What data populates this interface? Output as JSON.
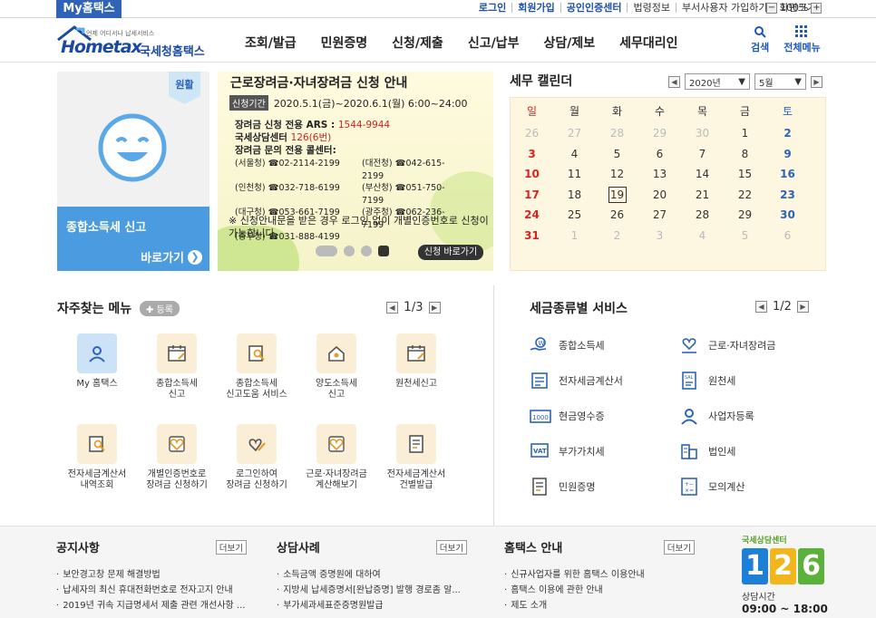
{
  "topbar": {
    "brand": "My홈택스",
    "links": [
      "로그인",
      "회원가입",
      "공인인증센터",
      "법령정보",
      "부서사용자 가입하기",
      "화면크기"
    ],
    "zoom_level": "100%"
  },
  "header": {
    "logo_small": "언제 어디서나 납세서비스",
    "logo_word": "Hometax",
    "logo_kr": "국세청홈택스",
    "nav": [
      "조회/발급",
      "민원증명",
      "신청/제출",
      "신고/납부",
      "상담/제보",
      "세무대리인"
    ],
    "search_label": "검색",
    "menu_label": "전체메뉴"
  },
  "promo": {
    "badge": "원활",
    "title": "종합소득세 신고",
    "go": "바로가기"
  },
  "banner": {
    "title": "근로장려금·자녀장려금 신청 안내",
    "period_tag": "신청기간",
    "period": "2020.5.1(금)~2020.6.1(월) 6:00~24:00",
    "ars_label": "장려금 신청 전용 ARS : ",
    "ars_num": "1544-9944",
    "center_label": "국세상담센터 ",
    "center_num": "126(6번)",
    "callcenter_label": "장려금 문의 전용 콜센터:",
    "phones": [
      "(서울청) ☎02-2114-2199",
      "(대전청) ☎042-615-2199",
      "(인천청) ☎032-718-6199",
      "(부산청) ☎051-750-7199",
      "(대구청) ☎053-661-7199",
      "(광주청) ☎062-236-7199",
      "(중부청) ☎031-888-4199"
    ],
    "note": "※ 신청안내문을 받은 경우 로그인 없이 개별인증번호로 신청이 가능합니다.",
    "apply": "신청 바로가기"
  },
  "calendar": {
    "title": "세무 캘린더",
    "year": "2020년",
    "month": "5월",
    "weekdays": [
      "일",
      "월",
      "화",
      "수",
      "목",
      "금",
      "토"
    ],
    "weeks": [
      [
        {
          "d": "26",
          "dim": true
        },
        {
          "d": "27",
          "dim": true
        },
        {
          "d": "28",
          "dim": true
        },
        {
          "d": "29",
          "dim": true
        },
        {
          "d": "30",
          "dim": true
        },
        {
          "d": "1"
        },
        {
          "d": "2",
          "b": true
        }
      ],
      [
        {
          "d": "3",
          "b": true
        },
        {
          "d": "4"
        },
        {
          "d": "5"
        },
        {
          "d": "6"
        },
        {
          "d": "7"
        },
        {
          "d": "8"
        },
        {
          "d": "9",
          "b": true
        }
      ],
      [
        {
          "d": "10",
          "b": true
        },
        {
          "d": "11"
        },
        {
          "d": "12"
        },
        {
          "d": "13"
        },
        {
          "d": "14"
        },
        {
          "d": "15"
        },
        {
          "d": "16",
          "b": true
        }
      ],
      [
        {
          "d": "17",
          "b": true
        },
        {
          "d": "18"
        },
        {
          "d": "19",
          "today": true
        },
        {
          "d": "20"
        },
        {
          "d": "21"
        },
        {
          "d": "22"
        },
        {
          "d": "23",
          "b": true
        }
      ],
      [
        {
          "d": "24",
          "b": true
        },
        {
          "d": "25"
        },
        {
          "d": "26"
        },
        {
          "d": "27"
        },
        {
          "d": "28"
        },
        {
          "d": "29"
        },
        {
          "d": "30",
          "b": true
        }
      ],
      [
        {
          "d": "31",
          "b": true
        },
        {
          "d": "1",
          "dim": true
        },
        {
          "d": "2",
          "dim": true
        },
        {
          "d": "3",
          "dim": true
        },
        {
          "d": "4",
          "dim": true
        },
        {
          "d": "5",
          "dim": true
        },
        {
          "d": "6",
          "dim": true
        }
      ]
    ]
  },
  "frequent": {
    "title": "자주찾는 메뉴",
    "register": "등록",
    "page_cur": "1",
    "page_total": "/3",
    "items": [
      {
        "l1": "My 홈택스",
        "l2": "",
        "icon": "person-icon",
        "blue": true
      },
      {
        "l1": "종합소득세",
        "l2": "신고",
        "icon": "calendar-icon"
      },
      {
        "l1": "종합소득세",
        "l2": "신고도움 서비스",
        "icon": "search-doc-icon"
      },
      {
        "l1": "양도소득세",
        "l2": "신고",
        "icon": "house-icon"
      },
      {
        "l1": "원천세신고",
        "l2": "",
        "icon": "calendar-icon"
      },
      {
        "l1": "전자세금계산서",
        "l2": "내역조회",
        "icon": "search-doc-icon"
      },
      {
        "l1": "개별인증번호로",
        "l2": "장려금 신청하기",
        "icon": "heart-icon"
      },
      {
        "l1": "로그인하여",
        "l2": "장려금 신청하기",
        "icon": "heart-pen-icon"
      },
      {
        "l1": "근로·자녀장려금",
        "l2": "계산해보기",
        "icon": "heart-icon"
      },
      {
        "l1": "전자세금계산서",
        "l2": "건별발급",
        "icon": "doc-icon"
      }
    ]
  },
  "tax": {
    "title": "세금종류별 서비스",
    "page_cur": "1",
    "page_total": "/2",
    "items": [
      {
        "label": "종합소득세",
        "icon": "hand-coin-icon"
      },
      {
        "label": "근로·자녀장려금",
        "icon": "heart-hand-icon"
      },
      {
        "label": "전자세금계산서",
        "icon": "invoice-icon"
      },
      {
        "label": "원천세",
        "icon": "receipt-icon"
      },
      {
        "label": "현금영수증",
        "icon": "cash-receipt-icon"
      },
      {
        "label": "사업자등록",
        "icon": "person-icon"
      },
      {
        "label": "부가가치세",
        "icon": "vat-icon"
      },
      {
        "label": "법인세",
        "icon": "building-icon"
      },
      {
        "label": "민원증명",
        "icon": "doc-icon"
      },
      {
        "label": "모의계산",
        "icon": "calculator-icon"
      }
    ]
  },
  "notice": {
    "title": "공지사항",
    "more": "더보기",
    "items": [
      "보안경고창 문제 해결방법",
      "납세자의 최신 휴대전화번호로 전자고지 안내",
      "2019년 귀속 지급명세서 제출 관련 개선사항 ..."
    ]
  },
  "consult": {
    "title": "상담사례",
    "more": "더보기",
    "items": [
      "소득금액 증명원에 대하여",
      "지방세 납세증명서[완납증명] 발행 경로좀 알...",
      "부가세과세표준증명원발급"
    ]
  },
  "guide": {
    "title": "홈택스 안내",
    "more": "더보기",
    "items": [
      "신규사업자를 위한 홈택스 이용안내",
      "홈택스 이용에 관한 안내",
      "제도 소개"
    ]
  },
  "center": {
    "label": "국세상담센터",
    "digits": [
      "1",
      "2",
      "6"
    ],
    "hours_label": "상담시간",
    "hours": "09:00 ~ 18:00"
  },
  "colors": {
    "brand_blue": "#2e63b8",
    "promo_blue": "#4a9be0",
    "calendar_bg": "#fdf7e1",
    "sunday": "#dd2222",
    "saturday": "#2e63b8"
  }
}
